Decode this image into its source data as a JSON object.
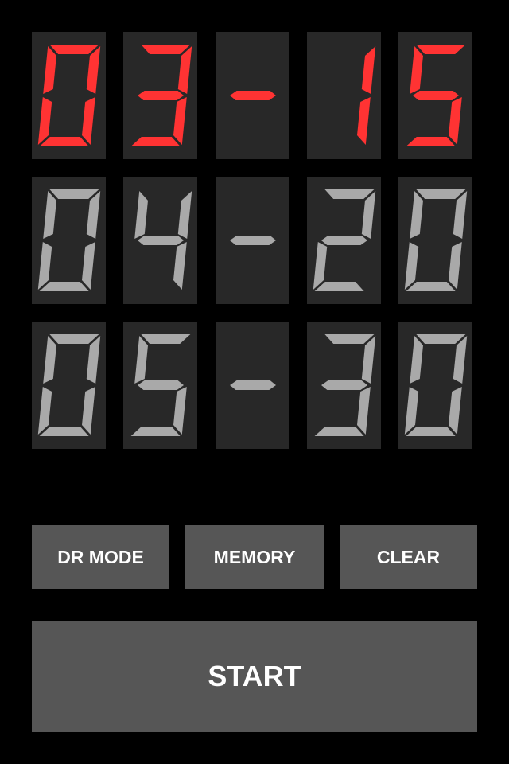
{
  "display": {
    "rows": [
      {
        "name": "current",
        "digits": [
          "0",
          "3",
          "-",
          "1",
          "5"
        ],
        "color": "#ff3333"
      },
      {
        "name": "row-2",
        "digits": [
          "0",
          "4",
          "-",
          "2",
          "0"
        ],
        "color": "#a9a9a9"
      },
      {
        "name": "row-3",
        "digits": [
          "0",
          "5",
          "-",
          "3",
          "0"
        ],
        "color": "#a9a9a9"
      }
    ],
    "cell_background": "#282828"
  },
  "buttons": {
    "dr_mode": "DR MODE",
    "memory": "MEMORY",
    "clear": "CLEAR",
    "start": "START"
  },
  "colors": {
    "button": "#565656",
    "background": "#000000",
    "active": "#ff3333",
    "inactive": "#a9a9a9"
  }
}
